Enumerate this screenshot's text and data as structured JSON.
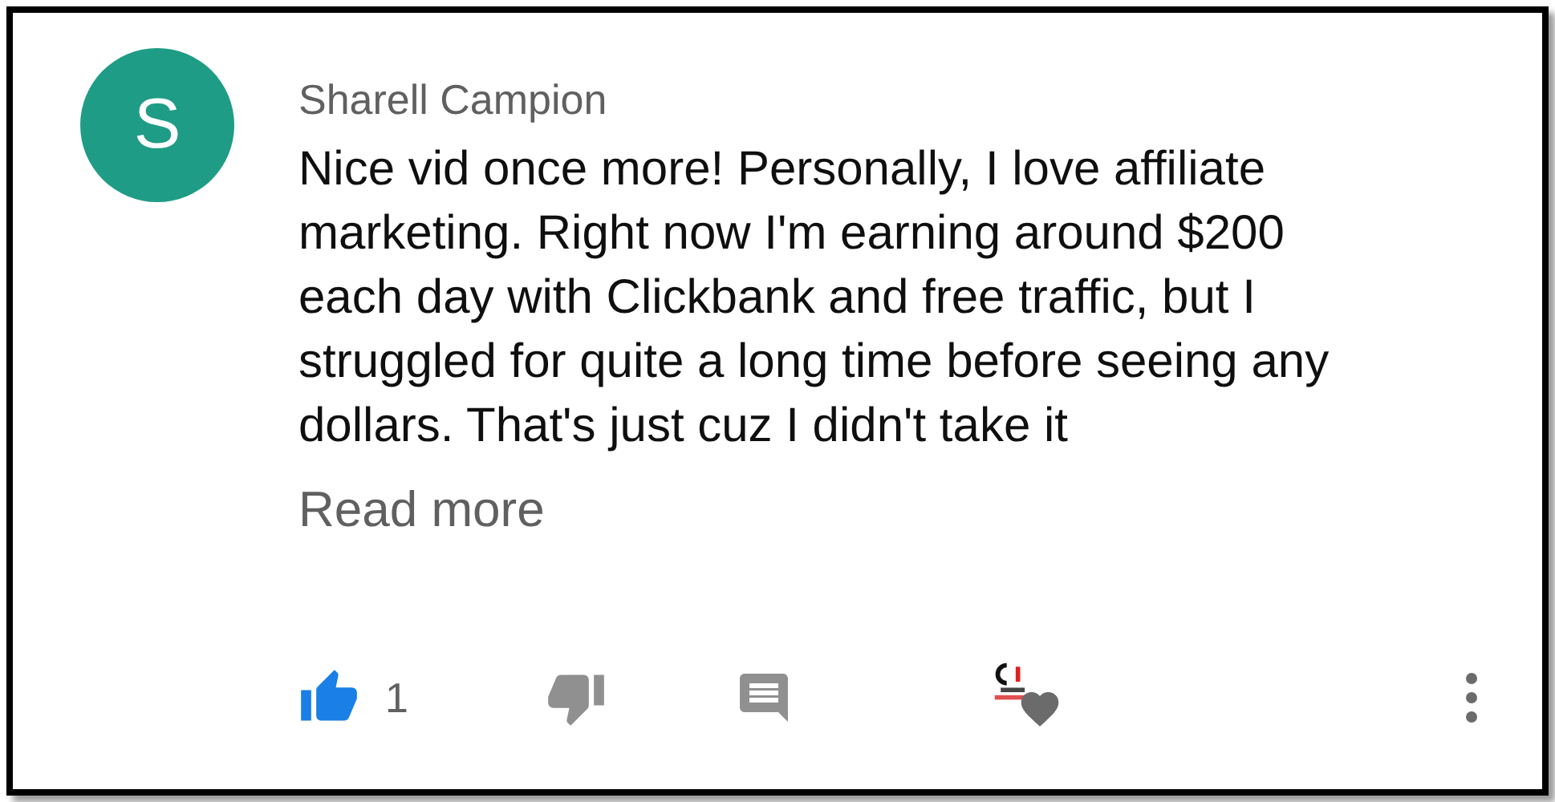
{
  "comment": {
    "avatar": {
      "letter": "S",
      "color": "#1e9c86"
    },
    "author": "Sharell Campion",
    "text": "Nice vid once more! Personally, I love affiliate marketing. Right now I'm earning around $200 each day with Clickbank and free traffic, but I struggled for quite a long time before seeing any dollars. That's just cuz I didn't take it",
    "read_more": "Read more",
    "liked": true,
    "like_count": "1",
    "hearted": true
  }
}
